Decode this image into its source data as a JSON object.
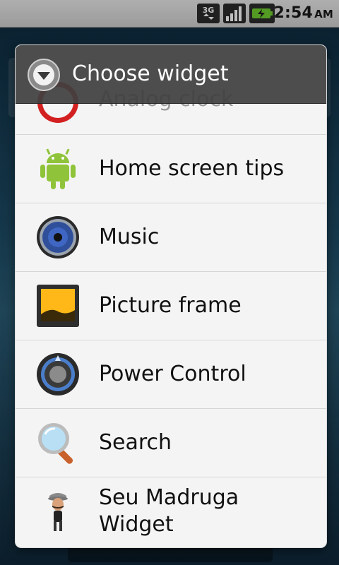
{
  "status_bar": {
    "network": "3G",
    "time": "2:54",
    "ampm": "AM"
  },
  "dialog": {
    "title": "Choose widget",
    "items": [
      {
        "label": "Analog clock",
        "icon": "clock-icon"
      },
      {
        "label": "Home screen tips",
        "icon": "android-robot-icon"
      },
      {
        "label": "Music",
        "icon": "speaker-icon"
      },
      {
        "label": "Picture frame",
        "icon": "picture-frame-icon"
      },
      {
        "label": "Power Control",
        "icon": "power-control-icon"
      },
      {
        "label": "Search",
        "icon": "magnifier-icon"
      },
      {
        "label": "Seu Madruga Widget",
        "icon": "madruga-character-icon"
      }
    ]
  }
}
